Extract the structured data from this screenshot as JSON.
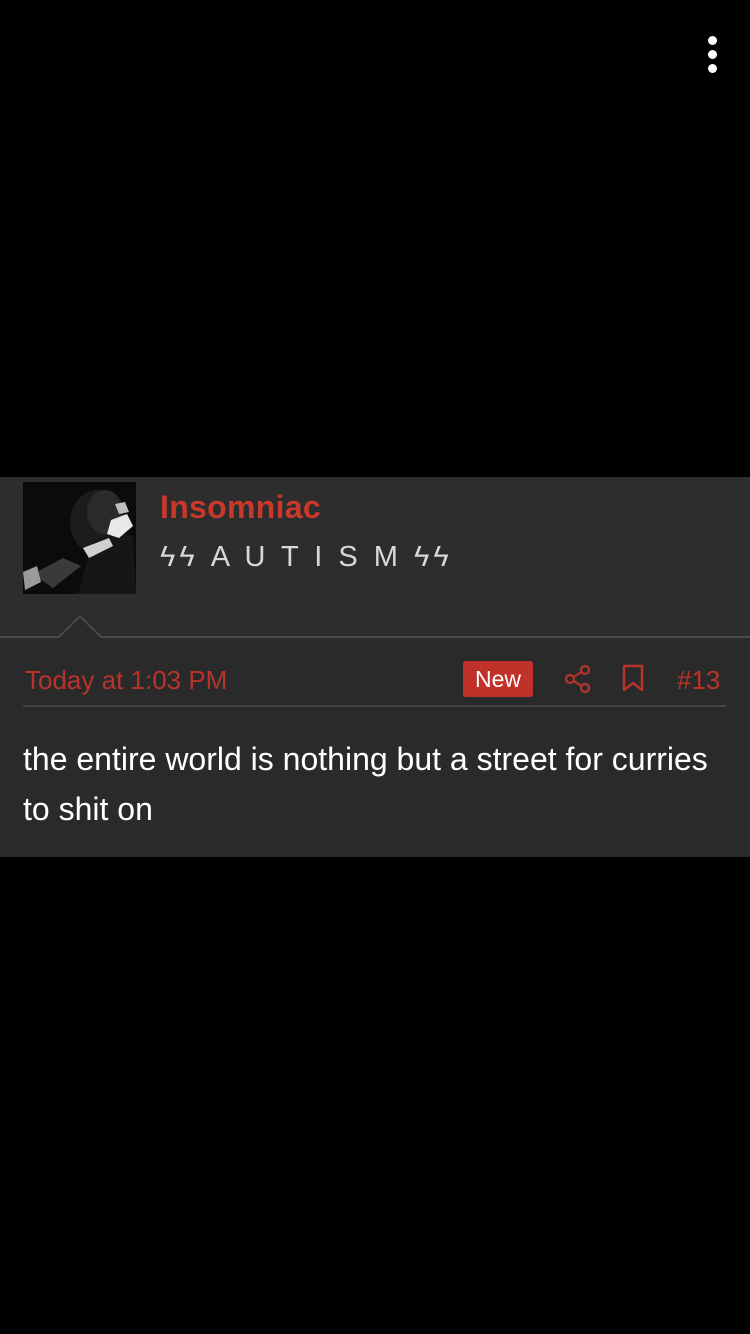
{
  "toolbar": {
    "menu_icon": "more-vertical-icon"
  },
  "post": {
    "author": {
      "name": "Insomniac",
      "title": "ϟϟ A U T I S M ϟϟ",
      "avatar_icon": "user-avatar-image"
    },
    "time": "Today at 1:03 PM",
    "badge": "New",
    "share_icon": "share-icon",
    "bookmark_icon": "bookmark-icon",
    "number": "#13",
    "body": "the entire world is nothing but a street for curries to shit on"
  },
  "colors": {
    "background": "#000000",
    "post_background": "#2a2a2a",
    "accent": "#c0312a",
    "text": "#ffffff"
  }
}
